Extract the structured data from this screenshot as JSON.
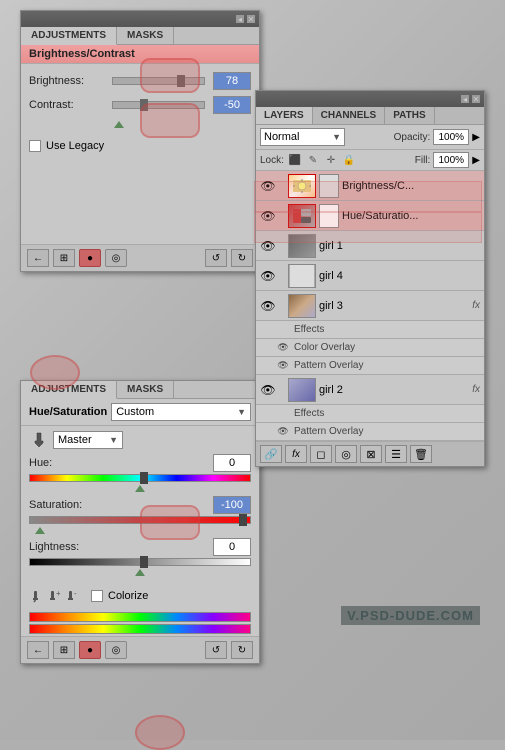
{
  "background": {
    "color": "#b0b0b0"
  },
  "adj_panel_top": {
    "title": "",
    "tabs": [
      "ADJUSTMENTS",
      "MASKS"
    ],
    "section_title": "Brightness/Contrast",
    "brightness_label": "Brightness:",
    "brightness_value": "78",
    "contrast_label": "Contrast:",
    "contrast_value": "-50",
    "legacy_label": "Use Legacy",
    "toolbar_buttons": [
      "←",
      "⊞",
      "●",
      "◎",
      "↺",
      "↻"
    ]
  },
  "adj_panel_bottom": {
    "tabs": [
      "ADJUSTMENTS",
      "MASKS"
    ],
    "section_title": "Hue/Saturation",
    "preset_label": "Custom",
    "master_label": "Master",
    "hue_label": "Hue:",
    "hue_value": "0",
    "saturation_label": "Saturation:",
    "saturation_value": "-100",
    "lightness_label": "Lightness:",
    "lightness_value": "0",
    "colorize_label": "Colorize",
    "toolbar_buttons": [
      "←",
      "⊞",
      "●",
      "◎",
      "↺",
      "↻"
    ]
  },
  "layers_panel": {
    "title": "",
    "tabs": [
      "LAYERS",
      "CHANNELS",
      "PATHS"
    ],
    "blend_mode": "Normal",
    "opacity_label": "Opacity:",
    "opacity_value": "100%",
    "lock_label": "Lock:",
    "fill_label": "Fill:",
    "fill_value": "100%",
    "layers": [
      {
        "name": "Brightness/C...",
        "type": "adjustment",
        "visible": true,
        "effects": []
      },
      {
        "name": "Hue/Saturatio...",
        "type": "adjustment",
        "visible": true,
        "effects": []
      },
      {
        "name": "girl 1",
        "type": "normal",
        "visible": true,
        "effects": [],
        "has_fx": false
      },
      {
        "name": "girl 4",
        "type": "normal",
        "visible": true,
        "effects": [],
        "has_fx": false
      },
      {
        "name": "girl 3",
        "type": "normal",
        "visible": true,
        "has_fx": true,
        "effects": [
          {
            "name": "Effects"
          },
          {
            "name": "Color Overlay"
          },
          {
            "name": "Pattern Overlay"
          }
        ]
      },
      {
        "name": "girl 2",
        "type": "normal",
        "visible": true,
        "has_fx": true,
        "effects": [
          {
            "name": "Effects"
          },
          {
            "name": "Pattern Overlay"
          }
        ]
      }
    ],
    "toolbar_buttons": [
      "🔗",
      "fx",
      "□",
      "◎",
      "⊠",
      "☰"
    ]
  },
  "watermark": "V.PSD-DUDE.COM"
}
